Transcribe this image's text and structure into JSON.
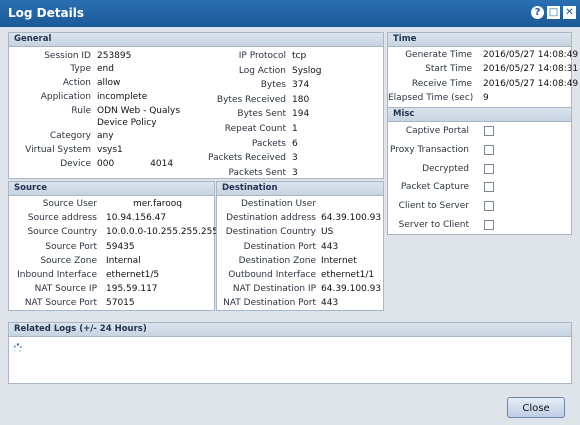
{
  "window": {
    "title": "Log Details",
    "help_icon": "?",
    "restore_icon": "□",
    "close_icon": "✕"
  },
  "general": {
    "header": "General",
    "left": [
      {
        "label": "Session ID",
        "value": "253895"
      },
      {
        "label": "Type",
        "value": "end"
      },
      {
        "label": "Action",
        "value": "allow"
      },
      {
        "label": "Application",
        "value": "incomplete"
      },
      {
        "label": "Rule",
        "value": "ODN Web - Qualys Device Policy"
      },
      {
        "label": "Category",
        "value": "any"
      },
      {
        "label": "Virtual System",
        "value": "vsys1"
      },
      {
        "label": "Device",
        "value": "000    4014"
      }
    ],
    "right": [
      {
        "label": "IP Protocol",
        "value": "tcp"
      },
      {
        "label": "Log Action",
        "value": "Syslog"
      },
      {
        "label": "Bytes",
        "value": "374"
      },
      {
        "label": "Bytes Received",
        "value": "180"
      },
      {
        "label": "Bytes Sent",
        "value": "194"
      },
      {
        "label": "Repeat Count",
        "value": "1"
      },
      {
        "label": "Packets",
        "value": "6"
      },
      {
        "label": "Packets Received",
        "value": "3"
      },
      {
        "label": "Packets Sent",
        "value": "3"
      }
    ]
  },
  "source": {
    "header": "Source",
    "rows": [
      {
        "label": "Source User",
        "value": "   mer.farooq"
      },
      {
        "label": "Source address",
        "value": "10.94.156.47"
      },
      {
        "label": "Source Country",
        "value": "10.0.0.0-10.255.255.255"
      },
      {
        "label": "Source Port",
        "value": "59435"
      },
      {
        "label": "Source Zone",
        "value": "Internal"
      },
      {
        "label": "Inbound Interface",
        "value": "ethernet1/5"
      },
      {
        "label": "NAT Source IP",
        "value": "195.59.117"
      },
      {
        "label": "NAT Source Port",
        "value": "57015"
      }
    ]
  },
  "destination": {
    "header": "Destination",
    "rows": [
      {
        "label": "Destination User",
        "value": ""
      },
      {
        "label": "Destination address",
        "value": "64.39.100.93"
      },
      {
        "label": "Destination Country",
        "value": "US"
      },
      {
        "label": "Destination Port",
        "value": "443"
      },
      {
        "label": "Destination Zone",
        "value": "Internet"
      },
      {
        "label": "Outbound Interface",
        "value": "ethernet1/1"
      },
      {
        "label": "NAT Destination IP",
        "value": "64.39.100.93"
      },
      {
        "label": "NAT Destination Port",
        "value": "443"
      }
    ]
  },
  "time": {
    "header": "Time",
    "rows": [
      {
        "label": "Generate Time",
        "value": "2016/05/27 14:08:49"
      },
      {
        "label": "Start Time",
        "value": "2016/05/27 14:08:31"
      },
      {
        "label": "Receive Time",
        "value": "2016/05/27 14:08:49"
      },
      {
        "label": "Elapsed Time (sec)",
        "value": "9"
      }
    ]
  },
  "misc": {
    "header": "Misc",
    "flags": [
      {
        "label": "Captive Portal",
        "checked": false
      },
      {
        "label": "Proxy Transaction",
        "checked": false
      },
      {
        "label": "Decrypted",
        "checked": false
      },
      {
        "label": "Packet Capture",
        "checked": false
      },
      {
        "label": "Client to Server",
        "checked": false
      },
      {
        "label": "Server to Client",
        "checked": false
      }
    ]
  },
  "related_logs": {
    "header": "Related Logs (+/- 24 Hours)"
  },
  "buttons": {
    "close_label": "Close"
  }
}
